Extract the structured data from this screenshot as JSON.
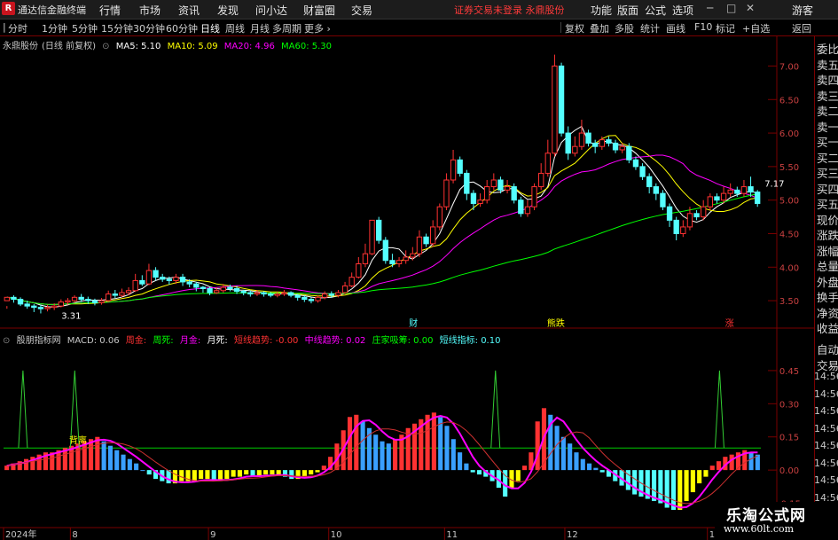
{
  "app": {
    "name": "通达信金融终端",
    "logo": "R"
  },
  "menu": [
    "行情",
    "市场",
    "资讯",
    "发现",
    "问小达",
    "财富圈",
    "交易"
  ],
  "warning": "证券交易未登录  永鼎股份",
  "right_menu": [
    "功能",
    "版面",
    "公式",
    "选项"
  ],
  "user": "游客",
  "periods": [
    "分时",
    "1分钟",
    "5分钟",
    "15分钟",
    "30分钟",
    "60分钟",
    "日线",
    "周线",
    "月线",
    "多周期",
    "更多"
  ],
  "active_period": "日线",
  "toolbar_buttons": [
    "复权",
    "叠加",
    "多股",
    "统计",
    "画线",
    "F10",
    "标记",
    "+自选",
    "返回"
  ],
  "stock": {
    "name": "永鼎股份",
    "mode": "(日线 前复权)"
  },
  "ma": {
    "ma5": "MA5: 5.10",
    "ma10": "MA10: 5.09",
    "ma20": "MA20: 4.96",
    "ma60": "MA60: 5.30"
  },
  "indicator": {
    "name": "殷朋指标网",
    "macd": "MACD: 0.06",
    "zhoujin": "周金:",
    "zhousi": "周死:",
    "yuejin": "月金:",
    "yuesi": "月死:",
    "short": "短线趋势: -0.00",
    "mid": "中线趋势: 0.02",
    "zhuang": "庄家吸筹: 0.00",
    "shortind": "短线指标: 0.10"
  },
  "side_items": [
    "委比",
    "卖五",
    "卖四",
    "卖三",
    "卖二",
    "卖一",
    "买一",
    "买二",
    "买三",
    "买四",
    "买五",
    "现价",
    "涨跌",
    "涨幅",
    "总量",
    "外盘",
    "换手",
    "净资",
    "收益"
  ],
  "side_lower": [
    "自动",
    "交易"
  ],
  "time_labels": [
    "14:56",
    "14:56",
    "14:56",
    "14:56",
    "14:56",
    "14:56",
    "14:56",
    "14:56"
  ],
  "watermark": {
    "line1": "乐淘公式网",
    "line2": "www.60lt.com"
  },
  "colors": {
    "up": "#ff3232",
    "down": "#54ffff",
    "ma5": "#ffffff",
    "ma10": "#ffff00",
    "ma20": "#ff00ff",
    "ma60": "#00ff00",
    "dif": "#ff00ff",
    "yellow": "#ffff00"
  },
  "chart_data": [
    {
      "type": "candlestick",
      "title": "永鼎股份 (日线 前复权)",
      "ylim": [
        3.25,
        7.35
      ],
      "price_ticks": [
        3.5,
        4.0,
        4.5,
        5.0,
        5.5,
        6.0,
        6.5,
        7.0
      ],
      "price_tick_labels": [
        "3.50",
        "4.00",
        "4.50",
        "5.00",
        "5.50",
        "6.00",
        "6.50",
        "7.00"
      ],
      "x_labels": [
        "2024年",
        "8",
        "9",
        "10",
        "11",
        "12",
        "1"
      ],
      "x_label_index": [
        0,
        15,
        46,
        73,
        99,
        126,
        158
      ],
      "annotations": [
        {
          "text": "3.31",
          "index": 7
        },
        {
          "text": "7.17",
          "index": 121
        }
      ],
      "markers": [
        {
          "text": "财",
          "index": 91
        },
        {
          "text": "熊跌",
          "index": 122
        },
        {
          "text": "涨",
          "index": 162
        }
      ],
      "candles": [
        [
          3.5,
          3.55,
          3.42,
          3.38
        ],
        [
          3.55,
          3.52,
          3.58,
          3.47
        ],
        [
          3.52,
          3.45,
          3.55,
          3.42
        ],
        [
          3.45,
          3.42,
          3.5,
          3.38
        ],
        [
          3.42,
          3.4,
          3.45,
          3.33
        ],
        [
          3.4,
          3.38,
          3.44,
          3.31
        ],
        [
          3.38,
          3.4,
          3.44,
          3.34
        ],
        [
          3.4,
          3.42,
          3.46,
          3.36
        ],
        [
          3.42,
          3.48,
          3.52,
          3.4
        ],
        [
          3.48,
          3.5,
          3.54,
          3.44
        ],
        [
          3.5,
          3.55,
          3.58,
          3.47
        ],
        [
          3.55,
          3.52,
          3.6,
          3.48
        ],
        [
          3.52,
          3.5,
          3.56,
          3.45
        ],
        [
          3.5,
          3.47,
          3.53,
          3.43
        ],
        [
          3.47,
          3.5,
          3.54,
          3.44
        ],
        [
          3.5,
          3.6,
          3.65,
          3.48
        ],
        [
          3.6,
          3.58,
          3.66,
          3.54
        ],
        [
          3.58,
          3.62,
          3.68,
          3.55
        ],
        [
          3.62,
          3.65,
          3.7,
          3.58
        ],
        [
          3.65,
          3.8,
          3.9,
          3.63
        ],
        [
          3.8,
          3.75,
          3.88,
          3.72
        ],
        [
          3.75,
          3.95,
          4.05,
          3.73
        ],
        [
          3.95,
          3.85,
          4.0,
          3.8
        ],
        [
          3.85,
          3.82,
          3.9,
          3.78
        ],
        [
          3.82,
          3.8,
          3.86,
          3.74
        ],
        [
          3.8,
          3.85,
          3.9,
          3.75
        ],
        [
          3.85,
          3.78,
          3.9,
          3.72
        ],
        [
          3.78,
          3.75,
          3.82,
          3.7
        ],
        [
          3.75,
          3.7,
          3.78,
          3.64
        ],
        [
          3.7,
          3.68,
          3.72,
          3.62
        ],
        [
          3.68,
          3.62,
          3.7,
          3.58
        ],
        [
          3.62,
          3.65,
          3.7,
          3.6
        ],
        [
          3.65,
          3.7,
          3.75,
          3.62
        ],
        [
          3.7,
          3.68,
          3.74,
          3.64
        ],
        [
          3.68,
          3.64,
          3.72,
          3.6
        ],
        [
          3.64,
          3.62,
          3.66,
          3.58
        ],
        [
          3.62,
          3.6,
          3.65,
          3.56
        ],
        [
          3.6,
          3.62,
          3.66,
          3.57
        ],
        [
          3.62,
          3.6,
          3.64,
          3.56
        ],
        [
          3.6,
          3.58,
          3.63,
          3.55
        ],
        [
          3.58,
          3.6,
          3.63,
          3.55
        ],
        [
          3.6,
          3.62,
          3.66,
          3.57
        ],
        [
          3.62,
          3.58,
          3.64,
          3.55
        ],
        [
          3.58,
          3.55,
          3.6,
          3.5
        ],
        [
          3.55,
          3.52,
          3.58,
          3.48
        ],
        [
          3.52,
          3.5,
          3.55,
          3.46
        ],
        [
          3.5,
          3.55,
          3.58,
          3.47
        ],
        [
          3.55,
          3.6,
          3.64,
          3.52
        ],
        [
          3.6,
          3.58,
          3.64,
          3.54
        ],
        [
          3.58,
          3.62,
          3.66,
          3.55
        ],
        [
          3.62,
          3.72,
          3.78,
          3.6
        ],
        [
          3.72,
          3.85,
          3.92,
          3.7
        ],
        [
          3.85,
          4.05,
          4.15,
          3.83
        ],
        [
          4.05,
          4.2,
          4.35,
          4.0
        ],
        [
          4.2,
          4.7,
          4.7,
          4.18
        ],
        [
          4.7,
          4.4,
          4.75,
          4.35
        ],
        [
          4.4,
          4.1,
          4.45,
          4.05
        ],
        [
          4.1,
          4.05,
          4.2,
          4.0
        ],
        [
          4.05,
          4.1,
          4.15,
          4.0
        ],
        [
          4.1,
          4.15,
          4.25,
          4.05
        ],
        [
          4.15,
          4.2,
          4.3,
          4.1
        ],
        [
          4.2,
          4.45,
          4.55,
          4.15
        ],
        [
          4.45,
          4.35,
          4.5,
          4.3
        ],
        [
          4.35,
          4.6,
          4.7,
          4.3
        ],
        [
          4.6,
          4.9,
          4.95,
          4.55
        ],
        [
          4.9,
          5.3,
          5.4,
          4.85
        ],
        [
          5.3,
          5.6,
          5.75,
          5.25
        ],
        [
          5.6,
          5.4,
          5.65,
          5.35
        ],
        [
          5.4,
          5.1,
          5.45,
          5.0
        ],
        [
          5.1,
          4.95,
          5.15,
          4.85
        ],
        [
          4.95,
          5.0,
          5.1,
          4.9
        ],
        [
          5.0,
          5.2,
          5.3,
          4.95
        ],
        [
          5.2,
          5.3,
          5.4,
          5.15
        ],
        [
          5.3,
          5.15,
          5.35,
          5.1
        ],
        [
          5.15,
          5.2,
          5.3,
          5.1
        ],
        [
          5.2,
          5.0,
          5.25,
          4.95
        ],
        [
          5.0,
          4.8,
          5.05,
          4.75
        ],
        [
          4.8,
          4.9,
          5.0,
          4.75
        ],
        [
          4.9,
          5.2,
          5.25,
          4.85
        ],
        [
          5.2,
          5.4,
          5.55,
          5.15
        ],
        [
          5.4,
          5.7,
          5.9,
          5.35
        ],
        [
          5.7,
          7.0,
          7.17,
          5.65
        ],
        [
          7.0,
          6.0,
          7.05,
          5.95
        ],
        [
          6.0,
          5.7,
          6.1,
          5.6
        ],
        [
          5.7,
          5.8,
          5.95,
          5.65
        ],
        [
          5.8,
          6.0,
          6.2,
          5.75
        ],
        [
          6.0,
          5.85,
          6.05,
          5.8
        ],
        [
          5.85,
          5.8,
          5.9,
          5.7
        ],
        [
          5.8,
          5.9,
          5.95,
          5.75
        ],
        [
          5.9,
          5.85,
          5.95,
          5.8
        ],
        [
          5.85,
          5.75,
          5.9,
          5.7
        ],
        [
          5.75,
          5.8,
          5.85,
          5.7
        ],
        [
          5.8,
          5.6,
          5.85,
          5.55
        ],
        [
          5.6,
          5.5,
          5.65,
          5.45
        ],
        [
          5.5,
          5.35,
          5.55,
          5.3
        ],
        [
          5.35,
          5.2,
          5.4,
          5.1
        ],
        [
          5.2,
          5.1,
          5.25,
          5.0
        ],
        [
          5.1,
          4.9,
          5.15,
          4.85
        ],
        [
          4.9,
          4.7,
          4.95,
          4.6
        ],
        [
          4.7,
          4.5,
          4.75,
          4.4
        ],
        [
          4.5,
          4.6,
          4.7,
          4.45
        ],
        [
          4.6,
          4.8,
          4.9,
          4.55
        ],
        [
          4.8,
          4.75,
          4.85,
          4.7
        ],
        [
          4.75,
          4.9,
          5.0,
          4.7
        ],
        [
          4.9,
          5.05,
          5.1,
          4.85
        ],
        [
          5.05,
          5.0,
          5.1,
          4.95
        ],
        [
          5.0,
          5.1,
          5.2,
          4.95
        ],
        [
          5.1,
          5.15,
          5.25,
          5.05
        ],
        [
          5.15,
          5.1,
          5.2,
          5.05
        ],
        [
          5.1,
          5.2,
          5.3,
          5.05
        ],
        [
          5.2,
          5.12,
          5.35,
          5.05
        ],
        [
          5.12,
          4.95,
          5.15,
          4.9
        ]
      ]
    },
    {
      "type": "bar",
      "title": "殷朋指标网",
      "ylim": [
        -0.22,
        0.57
      ],
      "y_ticks": [
        -0.15,
        0.0,
        0.15,
        0.3,
        0.45
      ],
      "y_tick_labels": [
        "-0.15",
        "0.00",
        "0.15",
        "0.30",
        "0.45"
      ],
      "reference_line": 0.1,
      "text_label": {
        "text": "背离",
        "index": 8
      },
      "macd_values": [
        0.02,
        0.03,
        0.04,
        0.05,
        0.06,
        0.07,
        0.08,
        0.08,
        0.09,
        0.1,
        0.11,
        0.12,
        0.13,
        0.14,
        0.15,
        0.13,
        0.11,
        0.09,
        0.07,
        0.05,
        0.03,
        0.0,
        -0.02,
        -0.04,
        -0.05,
        -0.06,
        -0.06,
        -0.05,
        -0.05,
        -0.05,
        -0.04,
        -0.04,
        -0.05,
        -0.05,
        -0.04,
        -0.03,
        -0.03,
        -0.02,
        -0.03,
        -0.03,
        -0.02,
        -0.02,
        -0.02,
        -0.03,
        -0.04,
        -0.04,
        -0.03,
        -0.02,
        -0.01,
        0.02,
        0.06,
        0.12,
        0.18,
        0.24,
        0.25,
        0.22,
        0.19,
        0.16,
        0.13,
        0.12,
        0.14,
        0.16,
        0.19,
        0.21,
        0.23,
        0.25,
        0.26,
        0.24,
        0.2,
        0.14,
        0.08,
        0.03,
        -0.01,
        -0.02,
        -0.03,
        -0.05,
        -0.08,
        -0.12,
        -0.08,
        -0.05,
        0.02,
        0.08,
        0.22,
        0.28,
        0.25,
        0.2,
        0.15,
        0.12,
        0.08,
        0.05,
        0.03,
        0.01,
        -0.01,
        -0.03,
        -0.05,
        -0.07,
        -0.09,
        -0.11,
        -0.12,
        -0.13,
        -0.14,
        -0.15,
        -0.17,
        -0.18,
        -0.18,
        -0.14,
        -0.1,
        -0.06,
        -0.03,
        0.02,
        0.04,
        0.06,
        0.07,
        0.08,
        0.09,
        0.08,
        0.07
      ],
      "spikes": [
        {
          "index": 3,
          "value": 0.45
        },
        {
          "index": 11,
          "value": 0.45
        },
        {
          "index": 76,
          "value": 0.45
        },
        {
          "index": 208,
          "value": 0.45
        }
      ]
    }
  ]
}
